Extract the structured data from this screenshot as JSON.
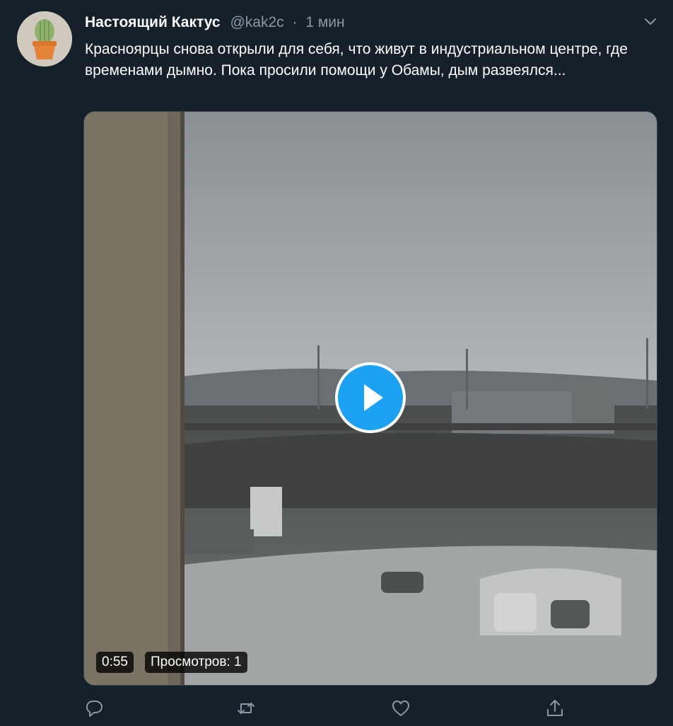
{
  "tweet": {
    "author": {
      "display_name": "Настоящий Кактус",
      "handle": "@kak2c"
    },
    "separator": "·",
    "time": "1 мин",
    "text": "Красноярцы снова открыли для себя, что живут в индустриальном центре, где временами дымно. Пока просили помощи у Обамы, дым развеялся...",
    "video": {
      "duration": "0:55",
      "views": "Просмотров: 1"
    }
  },
  "icons": {
    "menu": "chevron-down-icon",
    "reply": "reply-icon",
    "retweet": "retweet-icon",
    "like": "like-icon",
    "share": "share-icon",
    "play": "play-icon"
  },
  "colors": {
    "background": "#15202b",
    "secondary_text": "#8899a6",
    "accent": "#1da1f2"
  }
}
